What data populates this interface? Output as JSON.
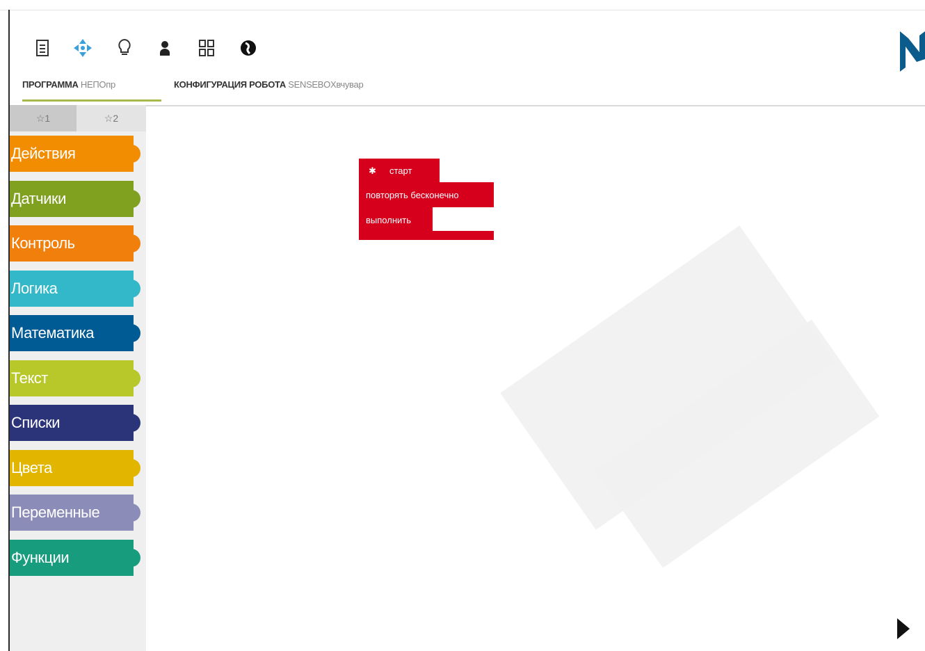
{
  "toolbar": {
    "icons": [
      "document-icon",
      "move-arrows-icon",
      "lightbulb-icon",
      "user-icon",
      "grid-icon",
      "globe-icon"
    ]
  },
  "tabs": {
    "program_bold": "ПРОГРАММА",
    "program_name": "НЕПОпр",
    "robot_bold": "КОНФИГУРАЦИЯ РОБОТА",
    "robot_name": "SENSEBOXвчувар"
  },
  "palette": {
    "tab_left": "☆1",
    "tab_right": "☆2",
    "categories": [
      {
        "label": "Действия",
        "color": "#f28c00"
      },
      {
        "label": "Датчики",
        "color": "#80a020"
      },
      {
        "label": "Контроль",
        "color": "#f07f0b"
      },
      {
        "label": "Логика",
        "color": "#33b8ca"
      },
      {
        "label": "Математика",
        "color": "#005a94"
      },
      {
        "label": "Текст",
        "color": "#b8c82a"
      },
      {
        "label": "Списки",
        "color": "#2c3479"
      },
      {
        "label": "Цвета",
        "color": "#e2b600"
      },
      {
        "label": "Переменные",
        "color": "#8c8cb8"
      },
      {
        "label": "Функции",
        "color": "#179c7d"
      }
    ]
  },
  "workspace": {
    "start_label": "старт",
    "loop_label": "повторять бесконечно",
    "do_label": "выполнить"
  }
}
